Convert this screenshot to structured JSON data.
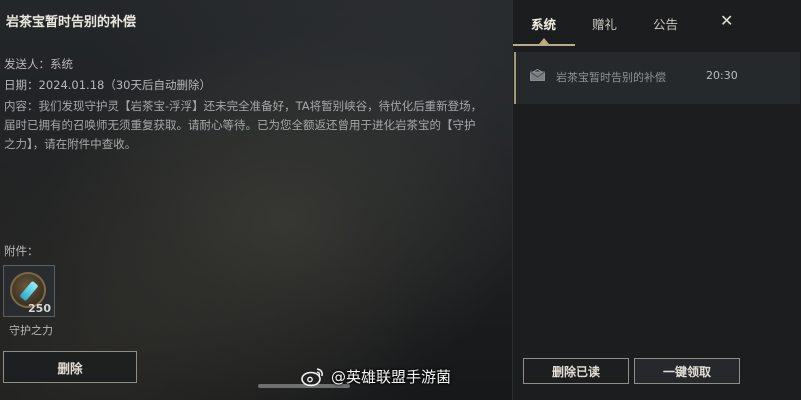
{
  "mail": {
    "title": "岩茶宝暂时告别的补偿",
    "sender": "发送人：系统",
    "date": "日期：2024.01.18（30天后自动删除）",
    "content": "内容：我们发现守护灵【岩茶宝-浮浮】还未完全准备好，TA将暂别峡谷，待优化后重新登场，届时已拥有的召唤师无须重复获取。请耐心等待。已为您全额返还曾用于进化岩茶宝的【守护之力】，请在附件中查收。",
    "attachments_label": "附件：",
    "attachment": {
      "name": "守护之力",
      "count": "250",
      "icon": "guardian-power-icon"
    },
    "delete_label": "删除"
  },
  "panel": {
    "tabs": [
      {
        "label": "系统",
        "active": true
      },
      {
        "label": "赠礼",
        "active": false
      },
      {
        "label": "公告",
        "active": false
      }
    ],
    "close_glyph": "✕",
    "list": [
      {
        "title": "岩茶宝暂时告别的补偿",
        "time": "20:30",
        "icon": "envelope-icon"
      }
    ],
    "delete_read_label": "删除已读",
    "claim_all_label": "一键领取"
  },
  "watermark": {
    "text": "@英雄联盟手游菌",
    "icon": "weibo-icon"
  },
  "colors": {
    "accent": "#b9ac86",
    "panel_bg": "#1b1d1f",
    "button_border": "#8f8d86"
  }
}
